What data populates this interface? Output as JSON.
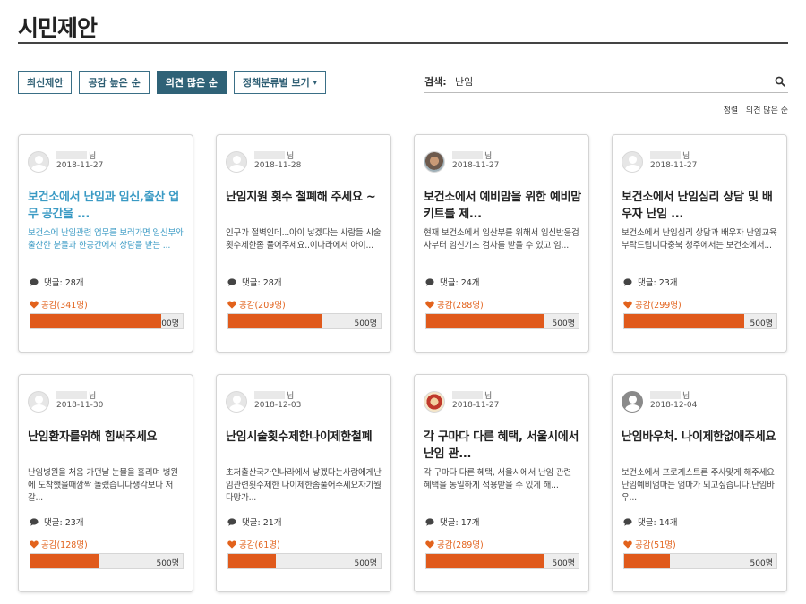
{
  "page": {
    "title": "시민제안"
  },
  "toolbar": {
    "buttons": [
      {
        "label": "최신제안",
        "active": false
      },
      {
        "label": "공감 높은 순",
        "active": false
      },
      {
        "label": "의견 많은 순",
        "active": true
      },
      {
        "label": "정책분류별 보기",
        "active": false,
        "caret": "▾"
      }
    ]
  },
  "search": {
    "label": "검색:",
    "value": "난임",
    "icon": "search-icon"
  },
  "sort_note": "정렬 : 의견 많은 순",
  "colors": {
    "accent": "#2f6277",
    "like": "#e05a1c",
    "highlight": "#3a9ac4"
  },
  "cards": [
    {
      "author_suffix": "님",
      "date": "2018-11-27",
      "avatar": "default",
      "title": "보건소에서 난임과 임신,출산 업무 공간을 ...",
      "excerpt": "보건소에 난임관련 업무를 보러가면 임신부와 출산한 분들과 한공간에서 상담을 받는 ...",
      "comments": "댓글: 28개",
      "likes": "공감(341명)",
      "like_ratio": 0.86,
      "target": "00명",
      "highlight": true
    },
    {
      "author_suffix": "님",
      "date": "2018-11-28",
      "avatar": "default",
      "title": "난임지원 횟수 철폐해 주세요 ~",
      "excerpt": "인구가 절벽인데...아이 낳겠다는 사람들 시술횟수제한좀 풀어주세요..이나라에서 아이...",
      "comments": "댓글: 28개",
      "likes": "공감(209명)",
      "like_ratio": 0.61,
      "target": "500명",
      "highlight": false
    },
    {
      "author_suffix": "님",
      "date": "2018-11-27",
      "avatar": "photo1",
      "title": "보건소에서 예비맘을 위한 예비맘 키트를 제...",
      "excerpt": "현재 보건소에서 임산부를 위해서 임신반응검사부터 임신기초 검사를 받을 수 있고 임...",
      "comments": "댓글: 24개",
      "likes": "공감(288명)",
      "like_ratio": 0.77,
      "target": "500명",
      "highlight": false
    },
    {
      "author_suffix": "님",
      "date": "2018-11-27",
      "avatar": "default",
      "title": "보건소에서 난임심리 상담 및 배우자 난임 ...",
      "excerpt": "보건소에서 난임심리 상담과 배우자 난임교육 부탁드립니다충북 청주에서는 보건소에서...",
      "comments": "댓글: 23개",
      "likes": "공감(299명)",
      "like_ratio": 0.79,
      "target": "500명",
      "highlight": false
    },
    {
      "author_suffix": "님",
      "date": "2018-11-30",
      "avatar": "default",
      "title": "난임환자를위해 힘써주세요",
      "excerpt": "난임병원을 처음 가던날 눈물을 흘리며 병원에 도착했을때깜짝 놀랬습니다생각보다 저갈...",
      "comments": "댓글: 23개",
      "likes": "공감(128명)",
      "like_ratio": 0.45,
      "target": "500명",
      "highlight": false
    },
    {
      "author_suffix": "님",
      "date": "2018-12-03",
      "avatar": "default",
      "title": "난임시술횟수제한나이제한철폐",
      "excerpt": "초저출산국가인나라에서 낳겠다는사람에게난임관련횟수제한 나이제한좀풀어주세요자기뭘다망가...",
      "comments": "댓글: 21개",
      "likes": "공감(61명)",
      "like_ratio": 0.31,
      "target": "500명",
      "highlight": false
    },
    {
      "author_suffix": "님",
      "date": "2018-11-27",
      "avatar": "photo2",
      "title": "각 구마다 다른 혜택, 서울시에서 난임 관...",
      "excerpt": "각 구마다 다른 혜택, 서울시에서 난임 관련 혜택을 동일하게 적용받을 수 있게 해...",
      "comments": "댓글: 17개",
      "likes": "공감(289명)",
      "like_ratio": 0.77,
      "target": "500명",
      "highlight": false
    },
    {
      "author_suffix": "님",
      "date": "2018-12-04",
      "avatar": "gray",
      "title": "난임바우처. 나이제한없애주세요",
      "excerpt": "보건소에서 프로게스트론 주사맞게 해주세요난임예비엄마는 엄마가 되고싶습니다.난임바우...",
      "comments": "댓글: 14개",
      "likes": "공감(51명)",
      "like_ratio": 0.3,
      "target": "500명",
      "highlight": false
    }
  ]
}
